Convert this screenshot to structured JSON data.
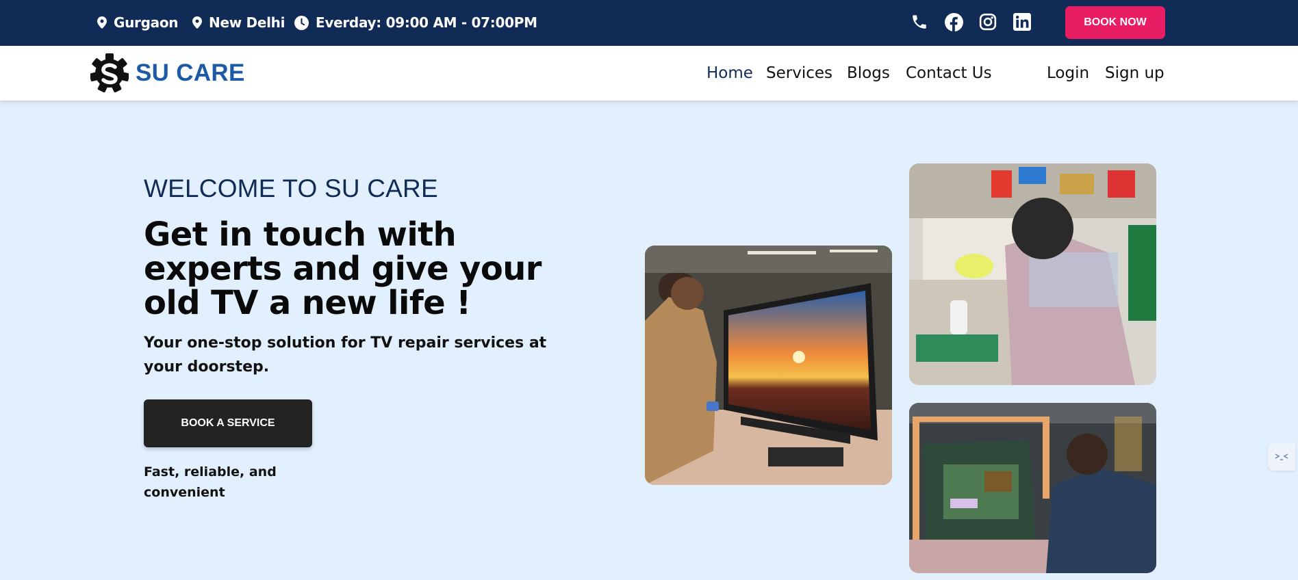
{
  "topbar": {
    "location1": "Gurgaon",
    "location2": "New Delhi",
    "hours": "Everday: 09:00 AM - 07:00PM",
    "book_now": "BOOK NOW",
    "social_icons": [
      "phone-icon",
      "facebook-icon",
      "instagram-icon",
      "linkedin-icon"
    ]
  },
  "header": {
    "brand": "SU CARE",
    "nav": [
      "Home",
      "Services",
      "Blogs",
      "Contact Us"
    ],
    "login": "Login",
    "signup": "Sign up"
  },
  "hero": {
    "kicker": "WELCOME TO SU CARE",
    "title": "Get in touch with experts and give your old TV a new life !",
    "subtitle": "Your one-stop solution for TV repair services at your doorstep.",
    "cta": "BOOK A SERVICE",
    "tagline": "Fast, reliable, and convenient"
  },
  "colors": {
    "topbar_bg": "#112b57",
    "accent": "#e81d63",
    "brand_blue": "#1d5aa6",
    "hero_bg": "#e2f0fd"
  }
}
